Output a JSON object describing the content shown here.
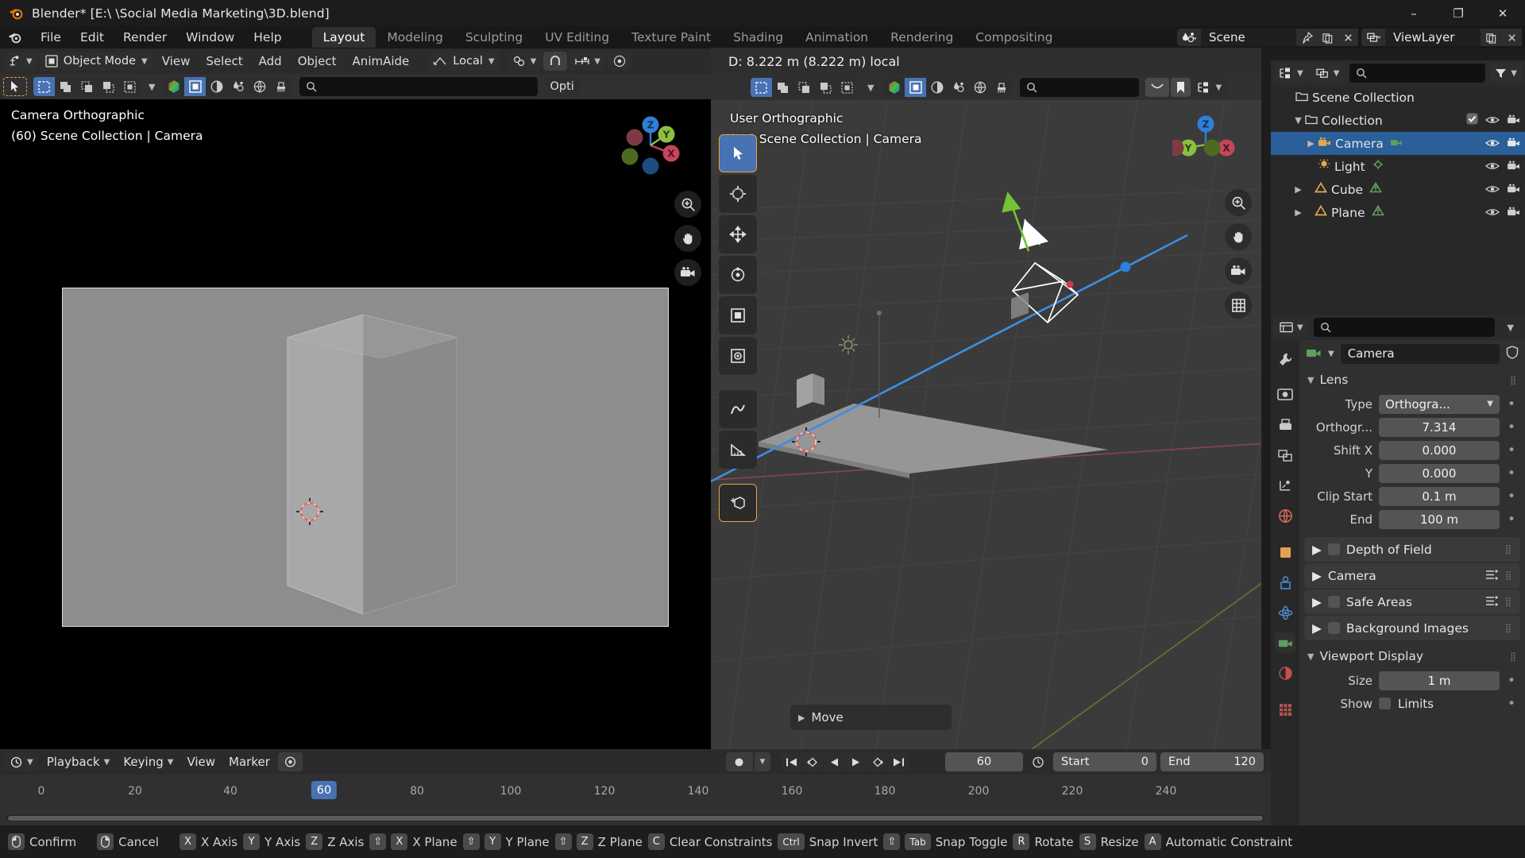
{
  "window": {
    "title": "Blender* [E:\\ \\Social Media Marketing\\3D.blend]",
    "minimize": "–",
    "maximize": "❐",
    "close": "✕"
  },
  "topbar": {
    "menus": [
      "File",
      "Edit",
      "Render",
      "Window",
      "Help"
    ],
    "workspaces": [
      {
        "label": "Layout",
        "active": true
      },
      {
        "label": "Modeling",
        "active": false
      },
      {
        "label": "Sculpting",
        "active": false
      },
      {
        "label": "UV Editing",
        "active": false
      },
      {
        "label": "Texture Paint",
        "active": false
      },
      {
        "label": "Shading",
        "active": false
      },
      {
        "label": "Animation",
        "active": false
      },
      {
        "label": "Rendering",
        "active": false
      },
      {
        "label": "Compositing",
        "active": false
      }
    ],
    "scene_name": "Scene",
    "viewlayer_name": "ViewLayer"
  },
  "viewport_left": {
    "mode": "Object Mode",
    "menus": [
      "View",
      "Select",
      "Add",
      "Object",
      "AnimAide"
    ],
    "transform_orientation": "Local",
    "options_label": "Opti",
    "view_name": "Camera Orthographic",
    "view_detail": "(60) Scene Collection | Camera",
    "gizmo_axes": [
      "Z",
      "Y",
      "X"
    ]
  },
  "viewport_right": {
    "status_overlay": "D: 8.222 m (8.222 m) local",
    "view_name": "User Orthographic",
    "view_detail": "(60) Scene Collection | Camera",
    "operator_panel": "Move",
    "gizmo_axes": [
      "Z",
      "Y",
      "X"
    ]
  },
  "outliner": {
    "search_placeholder": "",
    "rows": [
      {
        "label": "Scene Collection",
        "indent": 0,
        "icon": "collection-icon",
        "disclosure": "",
        "selected": false,
        "has_checkbox": false,
        "has_eye": false,
        "has_camera": false
      },
      {
        "label": "Collection",
        "indent": 1,
        "icon": "collection-icon",
        "disclosure": "▼",
        "selected": false,
        "has_checkbox": true,
        "has_eye": true,
        "has_camera": true
      },
      {
        "label": "Camera",
        "indent": 2,
        "icon": "camera-data-icon",
        "disclosure": "▶",
        "selected": true,
        "has_checkbox": false,
        "has_eye": true,
        "has_camera": true
      },
      {
        "label": "Light",
        "indent": 2,
        "icon": "light-data-icon",
        "disclosure": "",
        "selected": false,
        "has_checkbox": false,
        "has_eye": true,
        "has_camera": true
      },
      {
        "label": "Cube",
        "indent": 2,
        "icon": "mesh-data-icon",
        "disclosure": "▶",
        "selected": false,
        "has_checkbox": false,
        "has_eye": true,
        "has_camera": true
      },
      {
        "label": "Plane",
        "indent": 2,
        "icon": "mesh-data-icon",
        "disclosure": "▶",
        "selected": false,
        "has_checkbox": false,
        "has_eye": true,
        "has_camera": true
      }
    ]
  },
  "properties": {
    "breadcrumb_object": "Camera",
    "search_placeholder": "",
    "sections": [
      {
        "id": "lens",
        "title": "Lens",
        "expanded": true,
        "rows": [
          {
            "label": "Type",
            "value": "Orthogra...",
            "kind": "dropdown",
            "dot": true
          },
          {
            "label": "Orthogr...",
            "value": "7.314",
            "kind": "number",
            "dot": true
          },
          {
            "label": "Shift X",
            "value": "0.000",
            "kind": "number",
            "dot": true
          },
          {
            "label": "Y",
            "value": "0.000",
            "kind": "number",
            "dot": true
          },
          {
            "label": "Clip Start",
            "value": "0.1 m",
            "kind": "number",
            "dot": true
          },
          {
            "label": "End",
            "value": "100 m",
            "kind": "number",
            "dot": true
          }
        ]
      },
      {
        "id": "depth-of-field",
        "title": "Depth of Field",
        "expanded": false,
        "checkbox": true,
        "rows": []
      },
      {
        "id": "camera",
        "title": "Camera",
        "expanded": false,
        "checkbox": false,
        "rows": []
      },
      {
        "id": "safe-areas",
        "title": "Safe Areas",
        "expanded": false,
        "checkbox": true,
        "rows": []
      },
      {
        "id": "background-images",
        "title": "Background Images",
        "expanded": false,
        "checkbox": true,
        "rows": []
      },
      {
        "id": "viewport-display",
        "title": "Viewport Display",
        "expanded": true,
        "rows": [
          {
            "label": "Size",
            "value": "1 m",
            "kind": "number",
            "dot": true
          },
          {
            "label": "Show",
            "value": "Limits",
            "kind": "checkbox",
            "dot": true
          }
        ]
      }
    ]
  },
  "timeline": {
    "menus": [
      "Playback",
      "Keying",
      "View",
      "Marker"
    ],
    "current_frame": "60",
    "start_label": "Start",
    "start_value": "0",
    "end_label": "End",
    "end_value": "120",
    "ticks": [
      "0",
      "20",
      "40",
      "60",
      "80",
      "100",
      "120",
      "140",
      "160",
      "180",
      "200",
      "220",
      "240"
    ],
    "playhead_label": "60"
  },
  "statusbar": {
    "items": [
      {
        "keys": [
          "mouse-left"
        ],
        "label": "Confirm"
      },
      {
        "keys": [
          "mouse-right"
        ],
        "label": "Cancel"
      },
      {
        "keys": [
          "X"
        ],
        "label": "X Axis"
      },
      {
        "keys": [
          "Y"
        ],
        "label": "Y Axis"
      },
      {
        "keys": [
          "Z"
        ],
        "label": "Z Axis"
      },
      {
        "keys": [
          "⇧",
          "X"
        ],
        "label": "X Plane"
      },
      {
        "keys": [
          "⇧",
          "Y"
        ],
        "label": "Y Plane"
      },
      {
        "keys": [
          "⇧",
          "Z"
        ],
        "label": "Z Plane"
      },
      {
        "keys": [
          "C"
        ],
        "label": "Clear Constraints"
      },
      {
        "keys": [
          "Ctrl"
        ],
        "label": "Snap Invert"
      },
      {
        "keys": [
          "⇧",
          "Tab"
        ],
        "label": "Snap Toggle"
      },
      {
        "keys": [
          "R"
        ],
        "label": "Rotate"
      },
      {
        "keys": [
          "S"
        ],
        "label": "Resize"
      },
      {
        "keys": [
          "A"
        ],
        "label": "Automatic Constraint"
      }
    ]
  },
  "colors": {
    "accent_blue": "#4772b3",
    "select_orange": "#e8a33d",
    "axis_x": "#c7455a",
    "axis_y": "#8cbf3f",
    "axis_z": "#2f7fd8",
    "outliner_select": "#2a5f99"
  }
}
